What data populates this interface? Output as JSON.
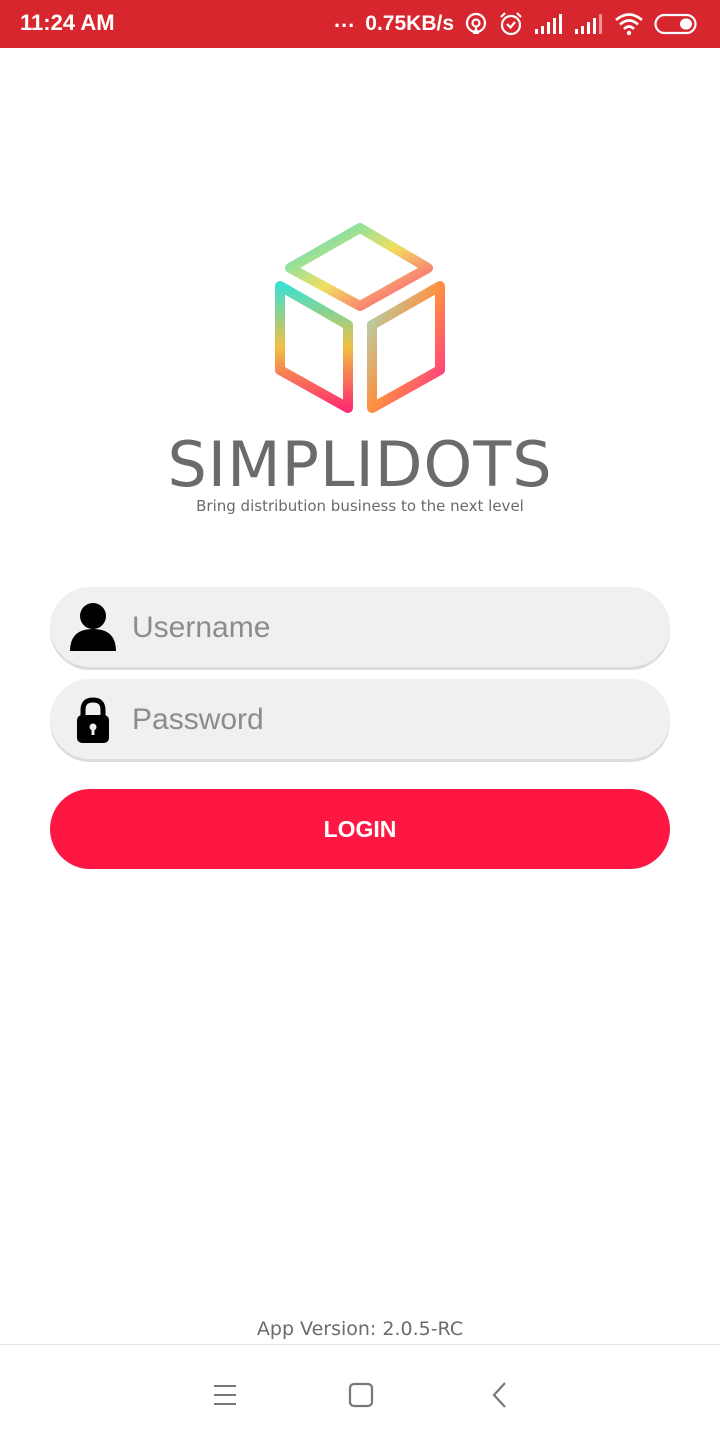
{
  "status_bar": {
    "time": "11:24 AM",
    "more": "...",
    "net_speed": "0.75KB/s",
    "icons": [
      "hotspot-icon",
      "alarm-icon",
      "signal-icon",
      "signal-icon",
      "wifi-icon",
      "battery-icon"
    ]
  },
  "logo": {
    "brand": "SIMPLIDOTS",
    "tagline": "Bring distribution business to the next level"
  },
  "form": {
    "username_placeholder": "Username",
    "password_placeholder": "Password",
    "login_label": "LOGIN"
  },
  "footer": {
    "app_version": "App Version: 2.0.5-RC"
  },
  "nav": {
    "icons": [
      "menu-icon",
      "home-square-icon",
      "back-icon"
    ]
  },
  "colors": {
    "status_bar": "#d8262f",
    "login_button": "#ff1744",
    "field_bg": "#f0f0f0"
  }
}
